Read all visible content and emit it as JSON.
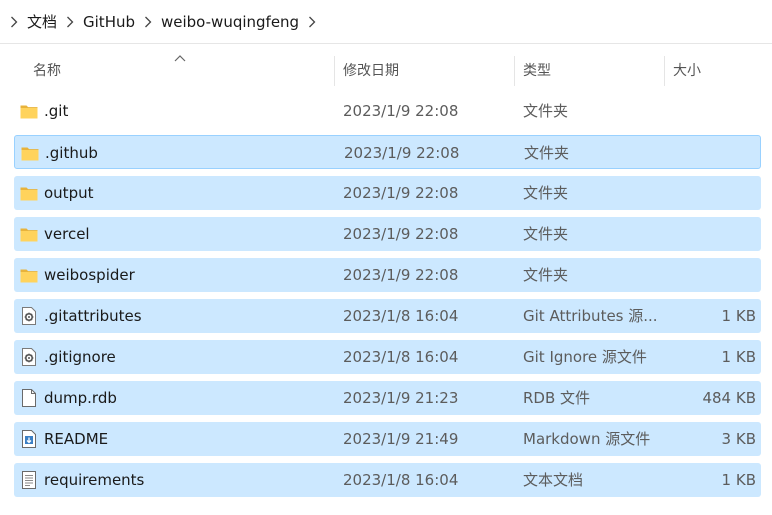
{
  "breadcrumb": {
    "items": [
      "文档",
      "GitHub",
      "weibo-wuqingfeng"
    ]
  },
  "columns": {
    "name": "名称",
    "date": "修改日期",
    "type": "类型",
    "size": "大小"
  },
  "files": [
    {
      "name": ".git",
      "date": "2023/1/9 22:08",
      "type": "文件夹",
      "size": "",
      "icon": "folder-icon",
      "selected": false
    },
    {
      "name": ".github",
      "date": "2023/1/9 22:08",
      "type": "文件夹",
      "size": "",
      "icon": "folder-icon",
      "selected": true
    },
    {
      "name": "output",
      "date": "2023/1/9 22:08",
      "type": "文件夹",
      "size": "",
      "icon": "folder-icon",
      "selected": true
    },
    {
      "name": "vercel",
      "date": "2023/1/9 22:08",
      "type": "文件夹",
      "size": "",
      "icon": "folder-icon",
      "selected": true
    },
    {
      "name": "weibospider",
      "date": "2023/1/9 22:08",
      "type": "文件夹",
      "size": "",
      "icon": "folder-icon",
      "selected": true
    },
    {
      "name": ".gitattributes",
      "date": "2023/1/8 16:04",
      "type": "Git Attributes 源...",
      "size": "1 KB",
      "icon": "settings-file-icon",
      "selected": true
    },
    {
      "name": ".gitignore",
      "date": "2023/1/8 16:04",
      "type": "Git Ignore 源文件",
      "size": "1 KB",
      "icon": "settings-file-icon",
      "selected": true
    },
    {
      "name": "dump.rdb",
      "date": "2023/1/9 21:23",
      "type": "RDB 文件",
      "size": "484 KB",
      "icon": "blank-file-icon",
      "selected": true
    },
    {
      "name": "README",
      "date": "2023/1/9 21:49",
      "type": "Markdown 源文件",
      "size": "3 KB",
      "icon": "markdown-file-icon",
      "selected": true
    },
    {
      "name": "requirements",
      "date": "2023/1/8 16:04",
      "type": "文本文档",
      "size": "1 KB",
      "icon": "text-file-icon",
      "selected": true
    }
  ]
}
